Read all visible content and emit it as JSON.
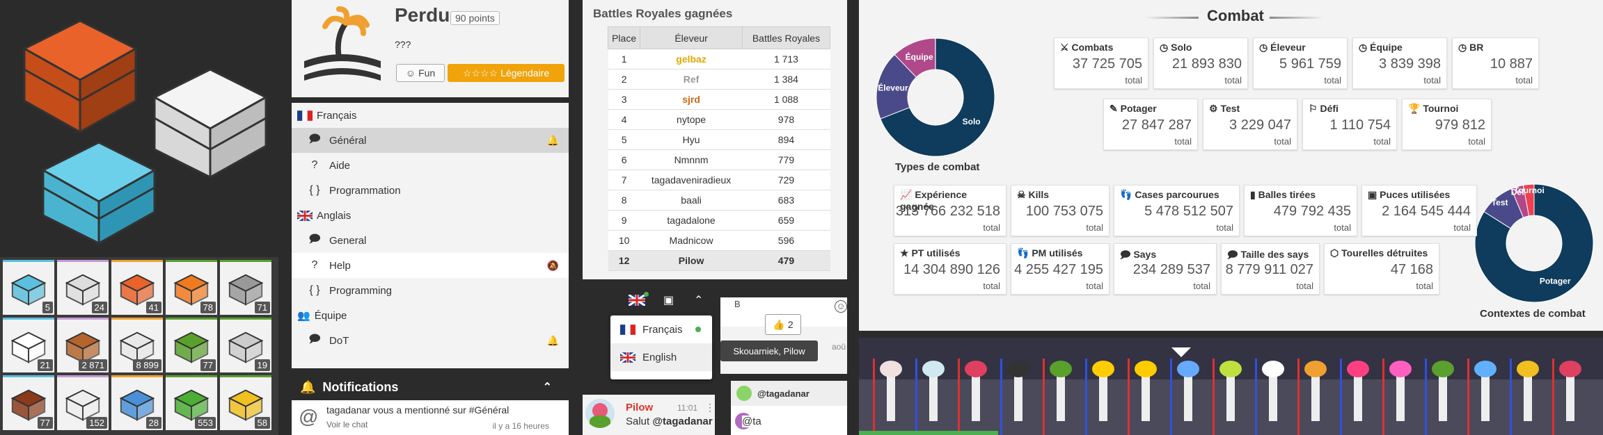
{
  "inventory": [
    {
      "item": "blue-chest",
      "count": "5",
      "color": "#5bc0de"
    },
    {
      "item": "white-chest",
      "count": "24",
      "color": "#ddd"
    },
    {
      "item": "orange-chest",
      "count": "41",
      "color": "#e8622a"
    },
    {
      "item": "carrot",
      "count": "78",
      "color": "#f07a20"
    },
    {
      "item": "wrench",
      "count": "71",
      "color": "#999"
    },
    {
      "item": "flower",
      "count": "21",
      "color": "#fff"
    },
    {
      "item": "wood",
      "count": "2 871",
      "color": "#b5642b"
    },
    {
      "item": "rock",
      "count": "8 899",
      "color": "#e8e8e8"
    },
    {
      "item": "leaves",
      "count": "77",
      "color": "#5aa02c"
    },
    {
      "item": "plate",
      "count": "19",
      "color": "#ccc"
    },
    {
      "item": "pinecone",
      "count": "77",
      "color": "#8b3a1a"
    },
    {
      "item": "fossil",
      "count": "152",
      "color": "#eee"
    },
    {
      "item": "ice-cube",
      "count": "28",
      "color": "#4a90d9"
    },
    {
      "item": "leaf",
      "count": "553",
      "color": "#4caf34"
    },
    {
      "item": "gold-pile",
      "count": "58",
      "color": "#f0c020"
    }
  ],
  "profile": {
    "name": "Perdu",
    "points": "90 points",
    "description": "???",
    "fun_label": "Fun",
    "legendary_label": "Légendaire"
  },
  "chat": {
    "groups": [
      {
        "name": "Français",
        "flag": "fr",
        "channels": [
          {
            "name": "Général",
            "icon": "speech",
            "selected": true,
            "bell": true
          },
          {
            "name": "Aide",
            "icon": "help"
          },
          {
            "name": "Programmation",
            "icon": "code"
          }
        ]
      },
      {
        "name": "Anglais",
        "flag": "uk",
        "channels": [
          {
            "name": "General",
            "icon": "speech"
          },
          {
            "name": "Help",
            "icon": "help",
            "highlight": true,
            "muted": true
          },
          {
            "name": "Programming",
            "icon": "code"
          }
        ]
      },
      {
        "name": "Équipe",
        "flag": "team",
        "channels": [
          {
            "name": "DoT",
            "icon": "speech",
            "bell": true
          }
        ]
      }
    ]
  },
  "notifications": {
    "title": "Notifications",
    "message": "tagadanar vous a mentionné sur #Général",
    "link": "Voir le chat",
    "time": "il y a 16 heures"
  },
  "battles": {
    "title": "Battles Royales gagnées",
    "headers": [
      "Place",
      "Éleveur",
      "Battles Royales"
    ],
    "rows": [
      {
        "place": "1",
        "name": "gelbaz",
        "value": "1 713",
        "color": "#e0a800"
      },
      {
        "place": "2",
        "name": "Ref",
        "value": "1 384",
        "color": "#999"
      },
      {
        "place": "3",
        "name": "sjrd",
        "value": "1 088",
        "color": "#c96a1a"
      },
      {
        "place": "4",
        "name": "nytope",
        "value": "978",
        "color": "#333"
      },
      {
        "place": "5",
        "name": "Hyu",
        "value": "894",
        "color": "#333"
      },
      {
        "place": "6",
        "name": "Nmnnm",
        "value": "779",
        "color": "#333"
      },
      {
        "place": "7",
        "name": "tagadaveniradieux",
        "value": "729",
        "color": "#333"
      },
      {
        "place": "8",
        "name": "baali",
        "value": "683",
        "color": "#333"
      },
      {
        "place": "9",
        "name": "tagadalone",
        "value": "659",
        "color": "#333"
      },
      {
        "place": "10",
        "name": "Madnicow",
        "value": "596",
        "color": "#333"
      },
      {
        "place": "12",
        "name": "Pilow",
        "value": "479",
        "color": "#333",
        "me": true
      }
    ]
  },
  "language_menu": {
    "items": [
      {
        "label": "Français",
        "flag": "fr",
        "online": true
      },
      {
        "label": "English",
        "flag": "uk",
        "selected": true
      }
    ]
  },
  "reaction": {
    "letter": "B",
    "emoji": "👍",
    "count": "2",
    "tooltip": "Skouarniek, Pilow",
    "partial": "aoû"
  },
  "chat_message": {
    "author": "Pilow",
    "time": "11:01",
    "text": "Salut ",
    "mention": "@tagadanar"
  },
  "mention_box": {
    "suggestion": "@tagadanar",
    "input": "@ta"
  },
  "combat": {
    "title": "Combat",
    "stats_row1": [
      {
        "icon": "swords",
        "label": "Combats",
        "value": "37 725 705",
        "unit": "total"
      },
      {
        "icon": "clock",
        "label": "Solo",
        "value": "21 893 830",
        "unit": "total"
      },
      {
        "icon": "clock",
        "label": "Éleveur",
        "value": "5 961 759",
        "unit": "total"
      },
      {
        "icon": "clock",
        "label": "Équipe",
        "value": "3 839 398",
        "unit": "total"
      },
      {
        "icon": "clock",
        "label": "BR",
        "value": "10 887",
        "unit": "total"
      }
    ],
    "stats_row2": [
      {
        "icon": "brush",
        "label": "Potager",
        "value": "27 847 287",
        "unit": "total"
      },
      {
        "icon": "gear",
        "label": "Test",
        "value": "3 229 047",
        "unit": "total"
      },
      {
        "icon": "flag",
        "label": "Défi",
        "value": "1 110 754",
        "unit": "total"
      },
      {
        "icon": "trophy",
        "label": "Tournoi",
        "value": "979 812",
        "unit": "total"
      }
    ],
    "stats_row3": [
      {
        "icon": "chart",
        "label": "Expérience gagnée",
        "value": "313 766 232 518",
        "unit": "total"
      },
      {
        "icon": "skull",
        "label": "Kills",
        "value": "100 753 075",
        "unit": "total"
      },
      {
        "icon": "steps",
        "label": "Cases parcourues",
        "value": "5 478 512 507",
        "unit": "total"
      },
      {
        "icon": "bullet",
        "label": "Balles tirées",
        "value": "479 792 435",
        "unit": "total"
      },
      {
        "icon": "chip",
        "label": "Puces utilisées",
        "value": "2 164 545 444",
        "unit": "total"
      }
    ],
    "stats_row4": [
      {
        "icon": "star",
        "label": "PT utilisés",
        "value": "14 304 890 126",
        "unit": "total"
      },
      {
        "icon": "steps",
        "label": "PM utilisés",
        "value": "4 255 427 195",
        "unit": "total"
      },
      {
        "icon": "speech",
        "label": "Says",
        "value": "234 289 537",
        "unit": "total"
      },
      {
        "icon": "speech",
        "label": "Taille des says",
        "value": "8 779 911 027",
        "unit": "total"
      },
      {
        "icon": "cube",
        "label": "Tourelles détruites",
        "value": "47 168",
        "unit": "total"
      }
    ],
    "types_caption": "Types de combat",
    "contexts_caption": "Contextes de combat"
  },
  "chart_data": [
    {
      "type": "pie",
      "title": "Types de combat",
      "categories": [
        "Solo",
        "Éleveur",
        "Équipe",
        "BR"
      ],
      "values": [
        21893830,
        5961759,
        3839398,
        10887
      ],
      "colors": [
        "#0f3b5c",
        "#4a4a8a",
        "#b0488a",
        "#f08030"
      ]
    },
    {
      "type": "pie",
      "title": "Contextes de combat",
      "categories": [
        "Potager",
        "Test",
        "Défi",
        "Tournoi"
      ],
      "values": [
        27847287,
        3229047,
        1110754,
        979812
      ],
      "colors": [
        "#0f3b5c",
        "#4a4a8a",
        "#b0488a",
        "#f04050"
      ]
    }
  ],
  "leeks": {
    "count": 17
  }
}
